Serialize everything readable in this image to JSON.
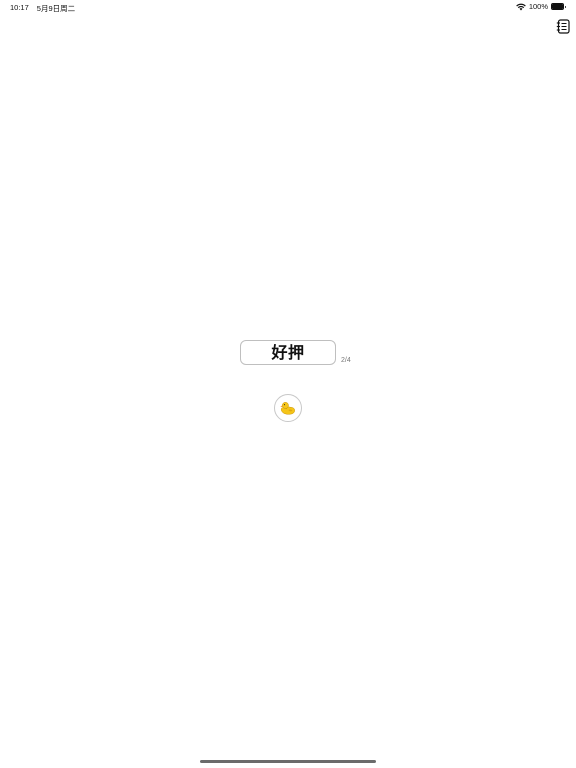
{
  "status_bar": {
    "time": "10:17",
    "date": "5月9日周二",
    "battery_percent": "100%",
    "battery_level": 1.0,
    "icons": [
      "wifi-icon",
      "battery-icon"
    ]
  },
  "toolbar": {
    "notebook_icon": "notebook-icon"
  },
  "card": {
    "word": "好押",
    "page_indicator": "2/4"
  },
  "duck_button": {
    "icon": "duck-icon"
  },
  "colors": {
    "background": "#ffffff",
    "card_border": "#bfbfbf",
    "text": "#111111",
    "secondary_text": "#777777",
    "duck_yellow": "#f5c518",
    "duck_beak": "#f08c1a"
  }
}
